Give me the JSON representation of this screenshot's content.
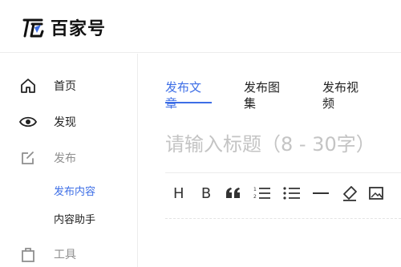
{
  "brand": {
    "name": "百家号"
  },
  "sidebar": {
    "home": "首页",
    "discover": "发现",
    "publish": "发布",
    "publish_sub": [
      "发布内容",
      "内容助手"
    ],
    "tools": "工具"
  },
  "tabs": [
    "发布文章",
    "发布图集",
    "发布视频"
  ],
  "editor": {
    "title_placeholder": "请输入标题（8 - 30字）"
  },
  "toolbar": {
    "heading": "H",
    "bold": "B"
  },
  "colors": {
    "accent": "#3d6ee6",
    "muted": "#8f8f8f"
  }
}
